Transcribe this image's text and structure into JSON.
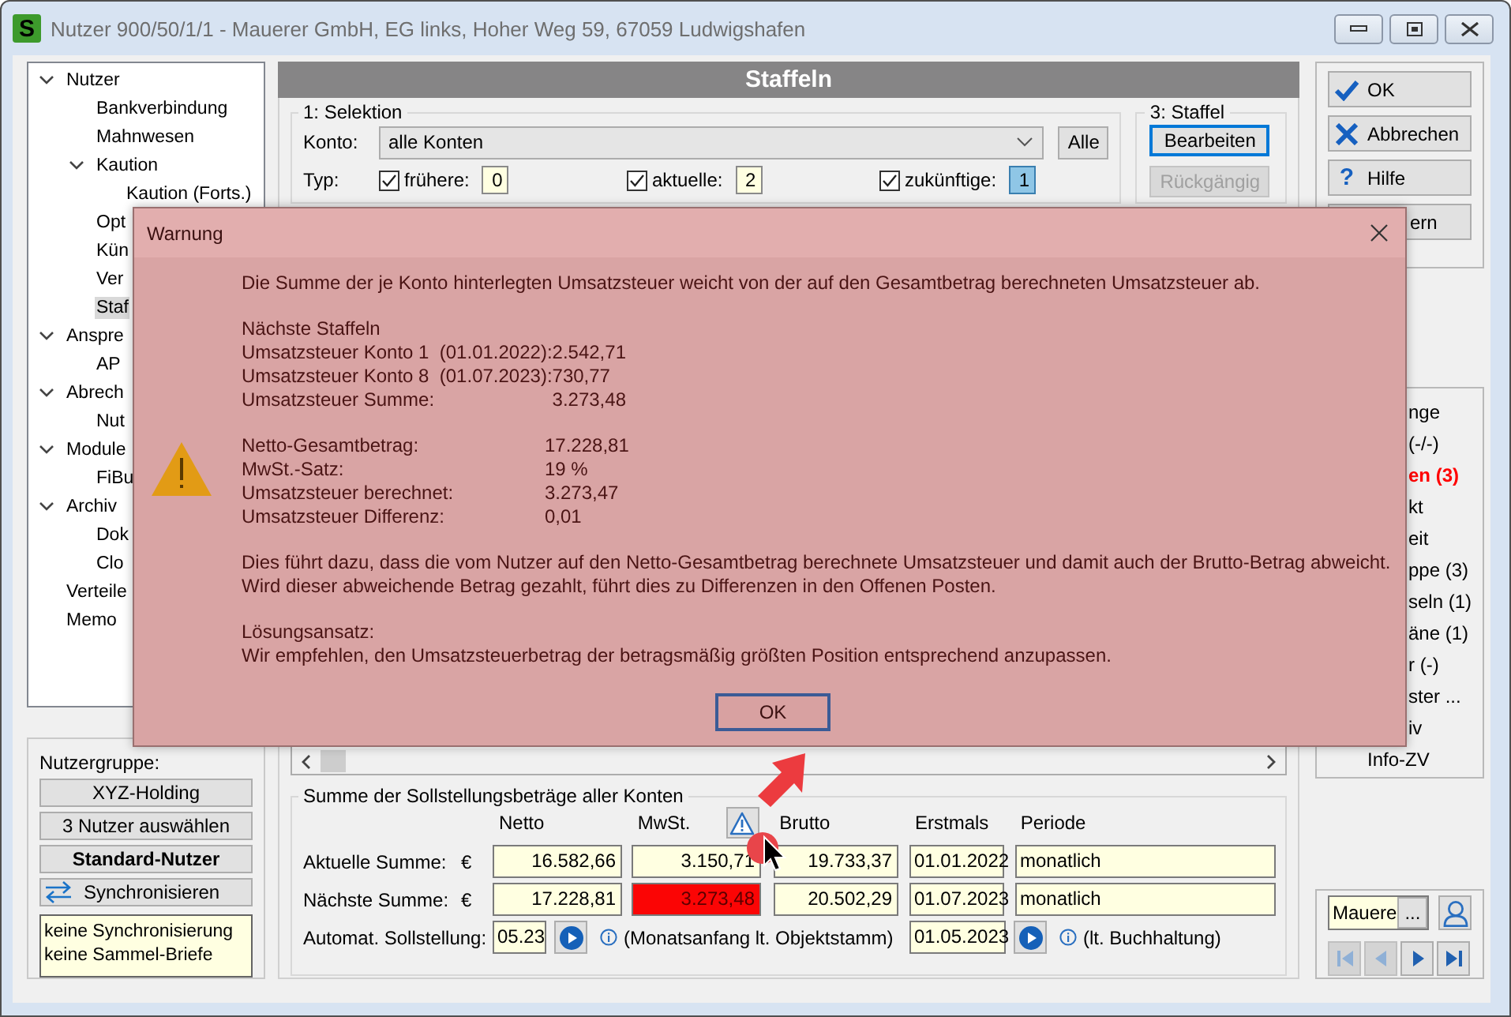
{
  "window": {
    "logo_text": "S",
    "title": "Nutzer 900/50/1/1 - Mauerer GmbH, EG links, Hoher Weg 59, 67059 Ludwigshafen"
  },
  "tree": [
    {
      "label": "Nutzer",
      "expanded": true,
      "selected": false,
      "children": [
        {
          "label": "Bankverbindung",
          "selected": false
        },
        {
          "label": "Mahnwesen",
          "selected": false
        },
        {
          "label": "Kaution",
          "expanded": true,
          "selected": false,
          "children": [
            {
              "label": "Kaution (Forts.)",
              "selected": false
            }
          ]
        },
        {
          "label": "Opt",
          "selected": false
        },
        {
          "label": "Kün",
          "selected": false
        },
        {
          "label": "Ver",
          "selected": false
        },
        {
          "label": "Staf",
          "selected": true
        }
      ]
    },
    {
      "label": "Anspre",
      "expanded": true,
      "selected": false,
      "children": [
        {
          "label": "AP",
          "selected": false
        }
      ]
    },
    {
      "label": "Abrech",
      "expanded": true,
      "selected": false,
      "children": [
        {
          "label": "Nut",
          "selected": false
        }
      ]
    },
    {
      "label": "Module",
      "expanded": true,
      "selected": false,
      "children": [
        {
          "label": "FiBu",
          "selected": false
        }
      ]
    },
    {
      "label": "Archiv",
      "expanded": true,
      "selected": false,
      "children": [
        {
          "label": "Dok",
          "selected": false
        },
        {
          "label": "Clo",
          "selected": false
        }
      ]
    },
    {
      "label": "Verteile",
      "selected": false
    },
    {
      "label": "Memo",
      "selected": false
    }
  ],
  "user_group": {
    "label": "Nutzergruppe:",
    "buttons": [
      {
        "label": "XYZ-Holding",
        "kind": "plain",
        "default": false
      },
      {
        "label": "3 Nutzer auswählen",
        "kind": "plain",
        "default": false
      },
      {
        "label": "Standard-Nutzer",
        "kind": "plain",
        "default": true
      },
      {
        "label": "Synchronisieren",
        "kind": "sync",
        "default": false
      }
    ],
    "note": [
      "keine Synchronisierung",
      "keine Sammel-Briefe"
    ]
  },
  "panel": {
    "title": "Staffeln"
  },
  "selection": {
    "legend": "1: Selektion",
    "account_label": "Konto:",
    "account_value": "alle Konten",
    "all_button": "Alle",
    "type_label": "Typ:",
    "types": [
      {
        "label": "frühere:",
        "checked": true,
        "count": "0",
        "selected": false
      },
      {
        "label": "aktuelle:",
        "checked": true,
        "count": "2",
        "selected": false
      },
      {
        "label": "zukünftige:",
        "checked": true,
        "count": "1",
        "selected": true
      }
    ]
  },
  "staffel": {
    "legend": "3: Staffel",
    "buttons": [
      {
        "label": "Bearbeiten",
        "focused": true,
        "disabled": false
      },
      {
        "label": "Rückgängig",
        "focused": false,
        "disabled": true
      }
    ]
  },
  "summary": {
    "legend": "Summe der Sollstellungsbeträge aller Konten",
    "columns": [
      {
        "label": "Netto",
        "kind": "amount"
      },
      {
        "label": "MwSt.",
        "kind": "amount"
      },
      {
        "label": "Brutto",
        "kind": "amount"
      },
      {
        "label": "Erstmals",
        "kind": "date"
      },
      {
        "label": "Periode",
        "kind": "text"
      }
    ],
    "rows": [
      {
        "label": "Aktuelle Summe:",
        "currency": "€",
        "cells": [
          {
            "value": "16.582,66",
            "alert": false
          },
          {
            "value": "3.150,71",
            "alert": false
          },
          {
            "value": "19.733,37",
            "alert": false
          },
          {
            "value": "01.01.2022",
            "alert": false
          },
          {
            "value": "monatlich",
            "alert": false
          }
        ]
      },
      {
        "label": "Nächste Summe:",
        "currency": "€",
        "cells": [
          {
            "value": "17.228,81",
            "alert": false
          },
          {
            "value": "3.273,48",
            "alert": true
          },
          {
            "value": "20.502,29",
            "alert": false
          },
          {
            "value": "01.07.2023",
            "alert": false
          },
          {
            "value": "monatlich",
            "alert": false
          }
        ]
      }
    ],
    "auto": {
      "label": "Automat. Sollstellung:",
      "value": "05.23",
      "note": "(Monatsanfang lt. Objektstamm)",
      "date": "01.05.2023",
      "date_note": "(lt. Buchhaltung)"
    }
  },
  "actions": [
    {
      "label": "OK",
      "kind": "check"
    },
    {
      "label": "Abbrechen",
      "kind": "cross"
    },
    {
      "label": "Hilfe",
      "kind": "help",
      "icon_text": "?"
    },
    {
      "label": "ern",
      "kind": "clipped"
    }
  ],
  "info_list": [
    {
      "label": "nge",
      "alert": false,
      "clipped": true
    },
    {
      "label": "(-/-)",
      "alert": false,
      "clipped": true
    },
    {
      "label": "en (3)",
      "alert": true,
      "clipped": true
    },
    {
      "label": "kt",
      "alert": false,
      "clipped": true
    },
    {
      "label": "eit",
      "alert": false,
      "clipped": true
    },
    {
      "label": "ppe (3)",
      "alert": false,
      "clipped": true
    },
    {
      "label": "seln (1)",
      "alert": false,
      "clipped": true
    },
    {
      "label": "äne (1)",
      "alert": false,
      "clipped": true
    },
    {
      "label": "r (-)",
      "alert": false,
      "clipped": true
    },
    {
      "label": "ster ...",
      "alert": false,
      "clipped": true
    },
    {
      "label": "iv",
      "alert": false,
      "clipped": true
    },
    {
      "label": "Info-ZV",
      "alert": false,
      "clipped": false
    }
  ],
  "navigator": {
    "value": "Mauere",
    "browse": "...",
    "buttons": [
      {
        "kind": "first",
        "disabled": true
      },
      {
        "kind": "prev",
        "disabled": true
      },
      {
        "kind": "next",
        "disabled": false
      },
      {
        "kind": "last",
        "disabled": false
      }
    ]
  },
  "dialog": {
    "title": "Warnung",
    "intro": "Die Summe der je Konto hinterlegten Umsatzsteuer weicht von der auf den Gesamtbetrag berechneten Umsatzsteuer ab.",
    "heading": "Nächste Staffeln",
    "lines": [
      {
        "label": "Umsatzsteuer Konto 1  (01.01.2022):",
        "value": "2.542,71"
      },
      {
        "label": "Umsatzsteuer Konto 8  (01.07.2023):",
        "value": "730,77"
      },
      {
        "label": "Umsatzsteuer Summe:",
        "value": "3.273,48"
      }
    ],
    "totals": [
      {
        "label": "Netto-Gesamtbetrag:",
        "value": "17.228,81"
      },
      {
        "label": "MwSt.-Satz:",
        "value": "19 %"
      },
      {
        "label": "Umsatzsteuer berechnet:",
        "value": "3.273,47"
      },
      {
        "label": "Umsatzsteuer Differenz:",
        "value": "0,01"
      }
    ],
    "consequence": [
      "Dies führt dazu, dass die vom Nutzer auf den Netto-Gesamtbetrag berechnete Umsatzsteuer und damit auch der Brutto-Betrag abweicht.",
      "Wird dieser abweichende Betrag gezahlt, führt dies zu Differenzen in den Offenen Posten."
    ],
    "solution_heading": "Lösungsansatz:",
    "solution": "Wir empfehlen, den Umsatzsteuerbetrag der betragsmäßig größten Position entsprechend anzupassen.",
    "button": "OK"
  }
}
